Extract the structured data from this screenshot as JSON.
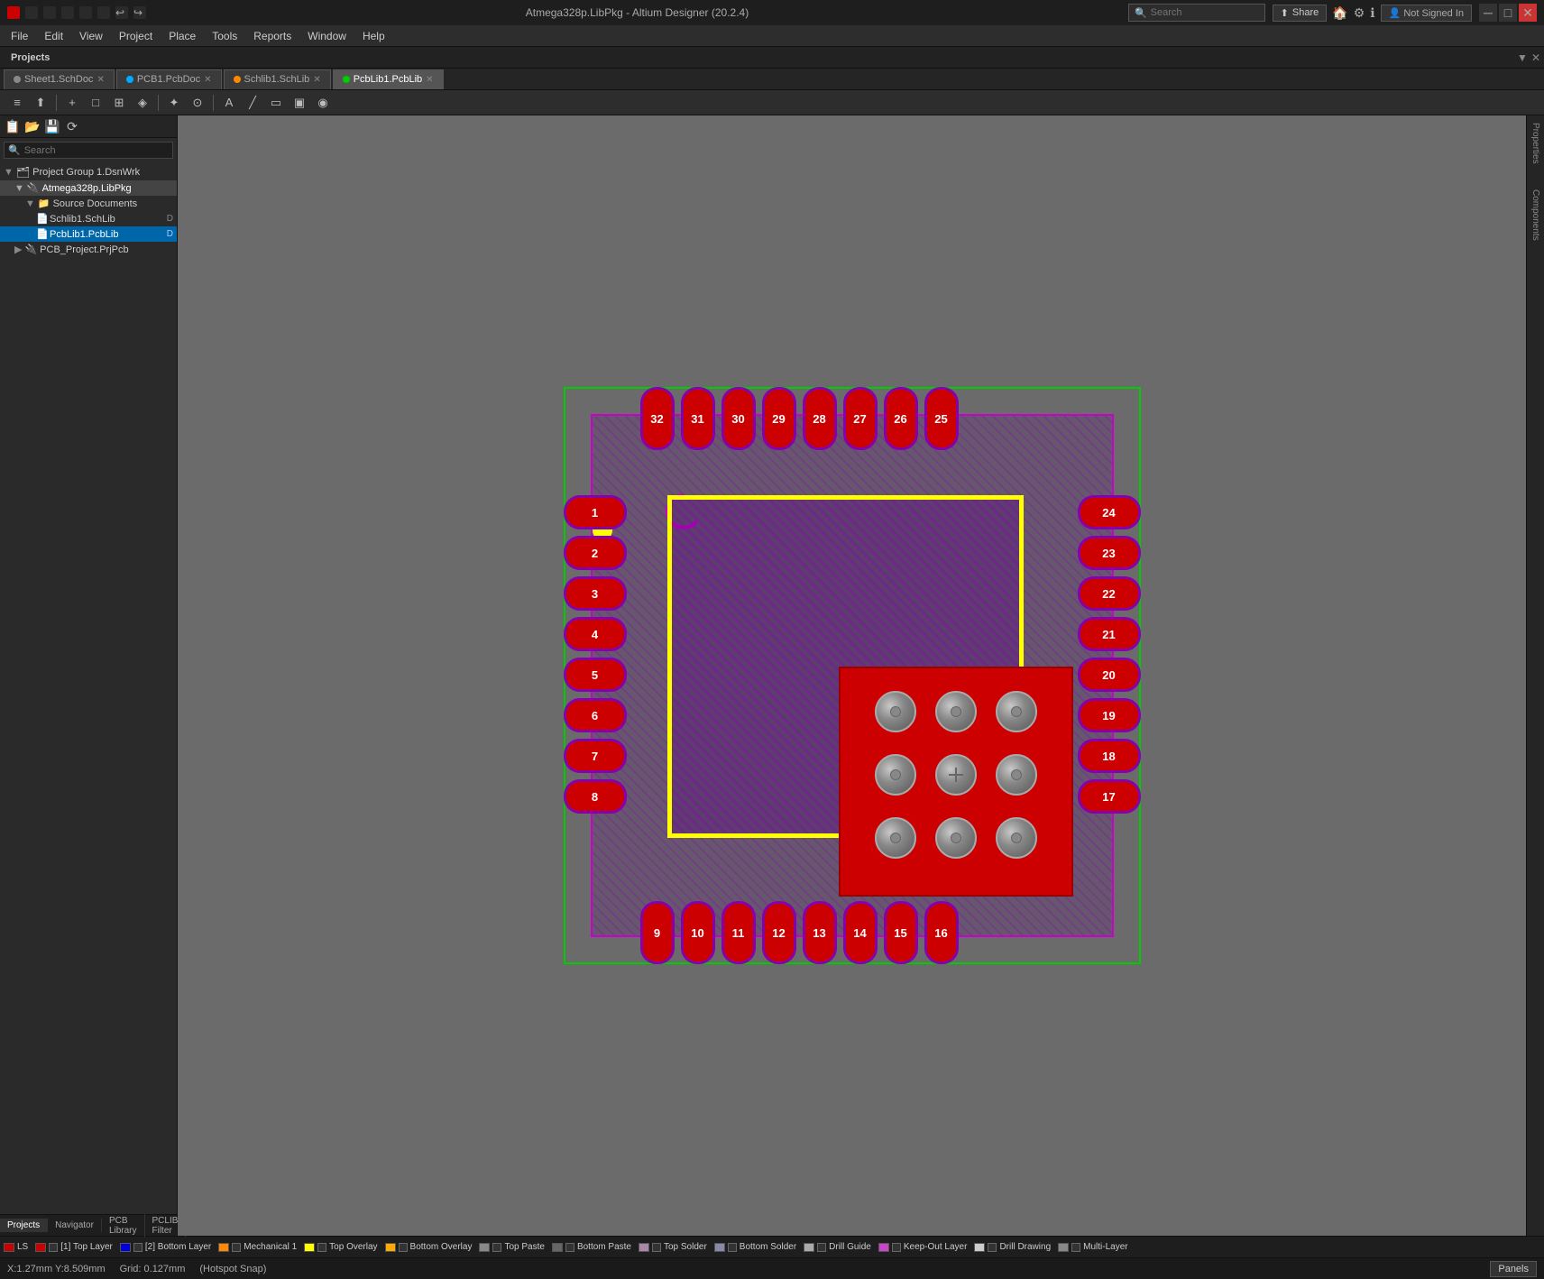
{
  "titlebar": {
    "title": "Atmega328p.LibPkg - Altium Designer (20.2.4)",
    "search_placeholder": "Search",
    "minimize": "─",
    "maximize": "□",
    "close": "✕"
  },
  "menubar": {
    "items": [
      "File",
      "Edit",
      "View",
      "Project",
      "Place",
      "Tools",
      "Reports",
      "Window",
      "Help"
    ]
  },
  "toolbar": {
    "tools": [
      "≡",
      "+",
      "□",
      "▦",
      "◆",
      "✦",
      "⊙",
      "A",
      "╱",
      "╔",
      "▣",
      "◉"
    ]
  },
  "tabs": [
    {
      "label": "Sheet1.SchDoc",
      "color": "#888",
      "active": false
    },
    {
      "label": "PCB1.PcbDoc",
      "color": "#00aaff",
      "active": false
    },
    {
      "label": "Schlib1.SchLib",
      "color": "#ff8800",
      "active": false
    },
    {
      "label": "PcbLib1.PcbLib",
      "color": "#00cc00",
      "active": true
    }
  ],
  "sidebar": {
    "title": "Projects",
    "search_placeholder": "Search",
    "tree": [
      {
        "label": "Project Group 1.DsnWrk",
        "indent": 0,
        "icon": "📁",
        "expanded": true
      },
      {
        "label": "Atmega328p.LibPkg",
        "indent": 1,
        "icon": "📦",
        "expanded": true,
        "selected": false
      },
      {
        "label": "Source Documents",
        "indent": 2,
        "icon": "📁",
        "expanded": true
      },
      {
        "label": "Schlib1.SchLib",
        "indent": 3,
        "icon": "📄",
        "selected": false
      },
      {
        "label": "PcbLib1.PcbLib",
        "indent": 3,
        "icon": "📄",
        "selected": true
      },
      {
        "label": "PCB_Project.PrjPcb",
        "indent": 1,
        "icon": "📦",
        "expanded": false
      }
    ],
    "bottom_tabs": [
      "Projects",
      "Navigator",
      "PCB Library",
      "PCLIB Filter"
    ]
  },
  "pcb": {
    "pins_left": [
      "1",
      "2",
      "3",
      "4",
      "5",
      "6",
      "7",
      "8"
    ],
    "pins_right": [
      "24",
      "23",
      "22",
      "21",
      "20",
      "19",
      "18",
      "17"
    ],
    "pins_top": [
      "32",
      "31",
      "30",
      "29",
      "28",
      "27",
      "26",
      "25"
    ],
    "pins_bottom": [
      "9",
      "10",
      "11",
      "12",
      "13",
      "14",
      "15",
      "16"
    ]
  },
  "layers": [
    {
      "label": "LS",
      "color": "#cc0000",
      "checked": true
    },
    {
      "label": "[1] Top Layer",
      "color": "#cc0000",
      "checked": true
    },
    {
      "label": "[2] Bottom Layer",
      "color": "#0000cc",
      "checked": true
    },
    {
      "label": "Mechanical 1",
      "color": "#ff8800",
      "checked": true
    },
    {
      "label": "Top Overlay",
      "color": "#ffff00",
      "checked": true
    },
    {
      "label": "Bottom Overlay",
      "color": "#ffaa00",
      "checked": true
    },
    {
      "label": "Top Paste",
      "color": "#888888",
      "checked": true
    },
    {
      "label": "Bottom Paste",
      "color": "#666666",
      "checked": true
    },
    {
      "label": "Top Solder",
      "color": "#aa88aa",
      "checked": true
    },
    {
      "label": "Bottom Solder",
      "color": "#8888aa",
      "checked": true
    },
    {
      "label": "Drill Guide",
      "color": "#aaaaaa",
      "checked": true
    },
    {
      "label": "Keep-Out Layer",
      "color": "#cc44cc",
      "checked": true
    },
    {
      "label": "Drill Drawing",
      "color": "#cccccc",
      "checked": true
    },
    {
      "label": "Multi-Layer",
      "color": "#888888",
      "checked": true
    }
  ],
  "status": {
    "coords": "X:1.27mm Y:8.509mm",
    "grid": "Grid: 0.127mm",
    "snap": "(Hotspot Snap)"
  },
  "right_panel": {
    "properties_label": "Properties",
    "components_label": "Components"
  },
  "top_right": {
    "share_label": "Share",
    "sign_in_label": "Not Signed In"
  }
}
